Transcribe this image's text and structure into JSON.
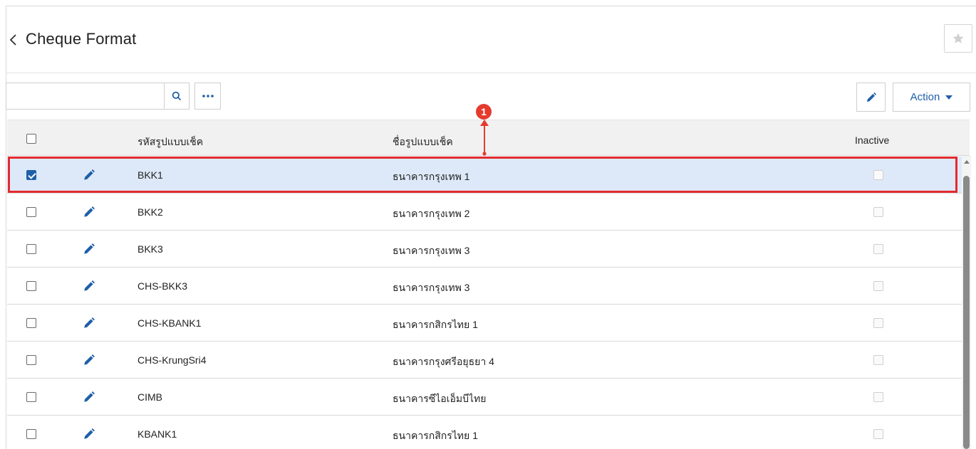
{
  "page": {
    "title": "Cheque Format"
  },
  "toolbar": {
    "search_value": "",
    "action_label": "Action"
  },
  "table": {
    "columns": {
      "code": "รหัสรูปแบบเช็ค",
      "name": "ชื่อรูปแบบเช็ค",
      "inactive": "Inactive"
    },
    "rows": [
      {
        "code": "BKK1",
        "name": "ธนาคารกรุงเทพ 1",
        "selected": true,
        "inactive": false
      },
      {
        "code": "BKK2",
        "name": "ธนาคารกรุงเทพ 2",
        "selected": false,
        "inactive": false
      },
      {
        "code": "BKK3",
        "name": "ธนาคารกรุงเทพ 3",
        "selected": false,
        "inactive": false
      },
      {
        "code": "CHS-BKK3",
        "name": "ธนาคารกรุงเทพ 3",
        "selected": false,
        "inactive": false
      },
      {
        "code": "CHS-KBANK1",
        "name": "ธนาคารกสิกรไทย 1",
        "selected": false,
        "inactive": false
      },
      {
        "code": "CHS-KrungSri4",
        "name": "ธนาคารกรุงศรีอยุธยา 4",
        "selected": false,
        "inactive": false
      },
      {
        "code": "CIMB",
        "name": "ธนาคารซีไอเอ็มบีไทย",
        "selected": false,
        "inactive": false
      },
      {
        "code": "KBANK1",
        "name": "ธนาคารกสิกรไทย 1",
        "selected": false,
        "inactive": false
      }
    ]
  },
  "annotation": {
    "marker": "1"
  },
  "colors": {
    "accent": "#1f5fa8",
    "selected_row": "#dde9f8",
    "highlight": "#e32b2f",
    "marker": "#e53b2e"
  },
  "icons": [
    "back-chevron-icon",
    "star-icon",
    "search-icon",
    "more-icon",
    "pencil-icon",
    "caret-down-icon"
  ]
}
